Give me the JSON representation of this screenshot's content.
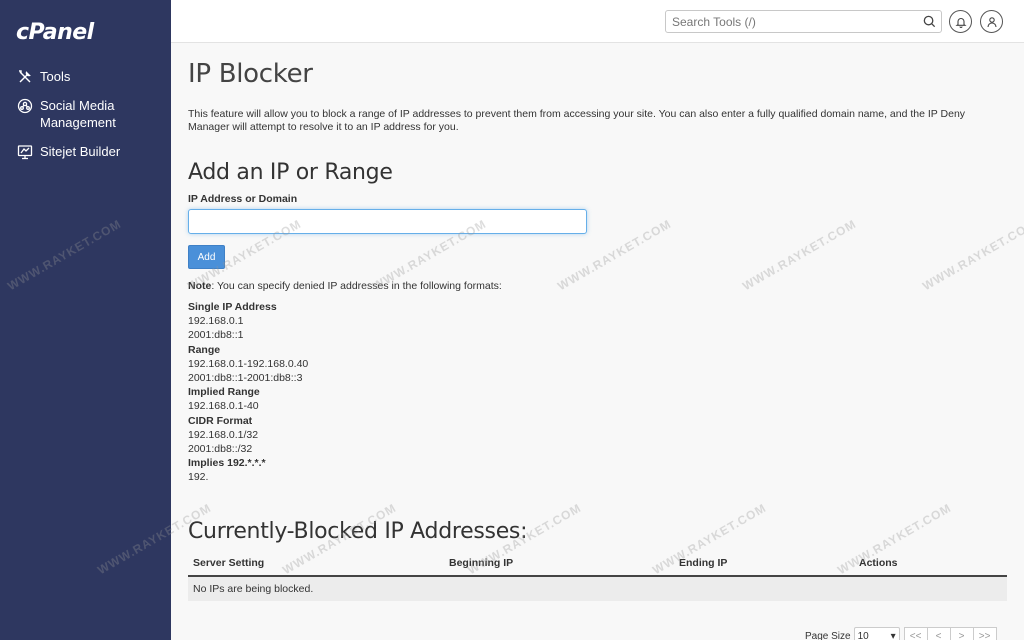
{
  "brand": {
    "logo": "cPanel"
  },
  "sidebar": {
    "items": [
      {
        "label": "Tools",
        "icon": "tools-icon"
      },
      {
        "label": "Social Media Management",
        "icon": "social-media-icon"
      },
      {
        "label": "Sitejet Builder",
        "icon": "sitejet-icon"
      }
    ]
  },
  "header": {
    "search_placeholder": "Search Tools (/)",
    "search_icon": "search-icon",
    "notifications_icon": "bell-icon",
    "user_icon": "user-icon"
  },
  "page": {
    "title": "IP Blocker",
    "description": "This feature will allow you to block a range of IP addresses to prevent them from accessing your site. You can also enter a fully qualified domain name, and the IP Deny Manager will attempt to resolve it to an IP address for you."
  },
  "add_form": {
    "heading": "Add an IP or Range",
    "field_label": "IP Address or Domain",
    "field_value": "",
    "add_label": "Add",
    "note_label": "Note",
    "note_text": ": You can specify denied IP addresses in the following formats:"
  },
  "formats": [
    {
      "title": "Single IP Address",
      "examples": [
        "192.168.0.1",
        "2001:db8::1"
      ]
    },
    {
      "title": "Range",
      "examples": [
        "192.168.0.1-192.168.0.40",
        "2001:db8::1-2001:db8::3"
      ]
    },
    {
      "title": "Implied Range",
      "examples": [
        "192.168.0.1-40"
      ]
    },
    {
      "title": "CIDR Format",
      "examples": [
        "192.168.0.1/32",
        "2001:db8::/32"
      ]
    },
    {
      "title": "Implies 192.*.*.*",
      "examples": [
        "192."
      ]
    }
  ],
  "blocked": {
    "heading": "Currently-Blocked IP Addresses:",
    "columns": [
      "Server Setting",
      "Beginning IP",
      "Ending IP",
      "Actions"
    ],
    "empty_message": "No IPs are being blocked."
  },
  "pager": {
    "label": "Page Size",
    "page_size": "10",
    "buttons": [
      "<<",
      "<",
      ">",
      ">>"
    ]
  },
  "watermark": "WWW.RAYKET.COM",
  "colors": {
    "sidebar": "#2e3760",
    "accent": "#4a90d9"
  }
}
